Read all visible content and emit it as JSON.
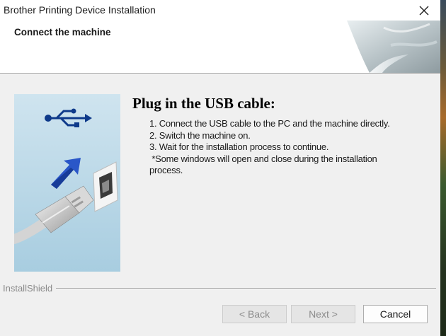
{
  "window": {
    "title": "Brother Printing Device Installation",
    "close_icon": "close-icon"
  },
  "header": {
    "title": "Connect the machine"
  },
  "content": {
    "heading": "Plug in the USB cable:",
    "steps": [
      "1. Connect  the USB cable to the PC and the machine directly.",
      "2. Switch the machine on.",
      "3. Wait for the installation process to continue.",
      " *Some windows will open and close during the installation",
      "process."
    ],
    "illustration_icons": [
      "usb-symbol-icon",
      "arrow-icon",
      "usb-port-icon",
      "usb-plug-icon"
    ]
  },
  "footer": {
    "brand": "InstallShield",
    "back_label": "< Back",
    "next_label": "Next >",
    "cancel_label": "Cancel"
  },
  "colors": {
    "dialog_bg": "#f0f0f0",
    "header_bg": "#ffffff",
    "illustration_bg": "#bcd9e8",
    "arrow_blue": "#2a57c8",
    "disabled_text": "#8c8c8c"
  }
}
